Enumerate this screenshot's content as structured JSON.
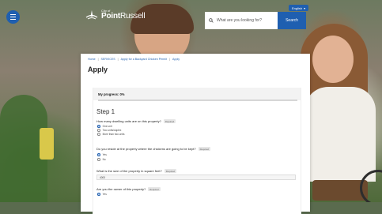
{
  "header": {
    "logo_small": "City of",
    "logo_bold": "Point",
    "logo_light": "Russell",
    "language": "English",
    "search": {
      "placeholder": "What are you looking for?",
      "button": "Search"
    }
  },
  "breadcrumb": [
    "Home",
    "SERVICES",
    "Apply for a Backyard Chicken Permit",
    "Apply"
  ],
  "page_title": "Apply",
  "progress": {
    "label": "My progress: 0%",
    "percent": 0
  },
  "step": {
    "title": "Step 1"
  },
  "questions": [
    {
      "text": "How many dwelling units are on this property?",
      "required": "Required",
      "options": [
        {
          "label": "One unit",
          "selected": true
        },
        {
          "label": "Two units/duplex",
          "selected": false
        },
        {
          "label": "More than two units",
          "selected": false
        }
      ]
    },
    {
      "text": "Do you reside at the property where the chickens are going to be kept?",
      "required": "Required",
      "options": [
        {
          "label": "Yes",
          "selected": true
        },
        {
          "label": "No",
          "selected": false
        }
      ]
    },
    {
      "text": "What is the size of the property in square feet?",
      "required": "Required",
      "value": "4000"
    },
    {
      "text": "Are you the owner of this property?",
      "required": "Required",
      "options": [
        {
          "label": "Yes",
          "selected": true
        }
      ]
    }
  ],
  "colors": {
    "accent": "#1f5fb0"
  }
}
